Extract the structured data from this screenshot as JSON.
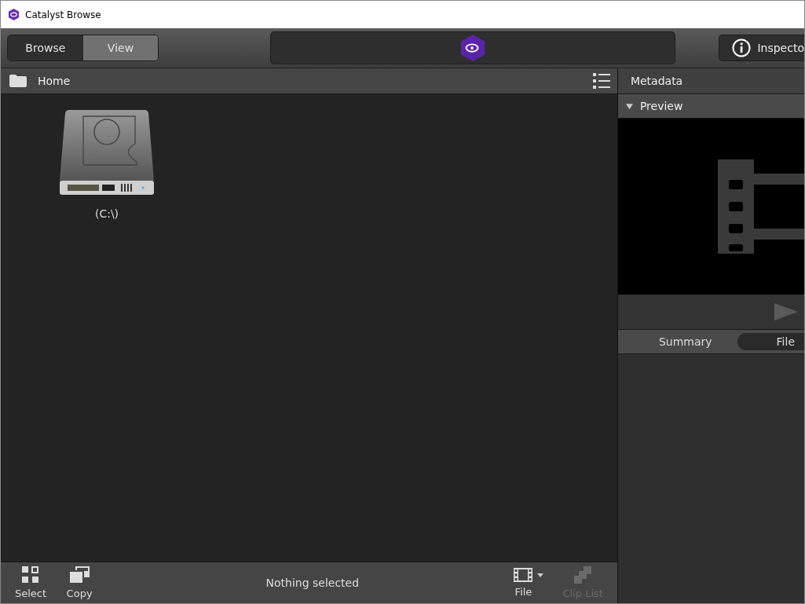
{
  "window": {
    "title": "Catalyst Browse"
  },
  "mode_tabs": [
    {
      "label": "Browse",
      "selected": false
    },
    {
      "label": "View",
      "selected": true
    }
  ],
  "inspector_button": {
    "label": "Inspecto"
  },
  "location": {
    "label": "Home"
  },
  "items": [
    {
      "label": "(C:\\)"
    }
  ],
  "metadata": {
    "title": "Metadata",
    "preview": {
      "label": "Preview",
      "expanded": true
    },
    "tabs": [
      {
        "label": "Summary",
        "selected": false
      },
      {
        "label": "File",
        "selected": true
      }
    ]
  },
  "footer": {
    "status": "Nothing selected",
    "actions": [
      {
        "kind": "select",
        "label": "Select",
        "disabled": false
      },
      {
        "kind": "copy",
        "label": "Copy",
        "disabled": false
      },
      {
        "kind": "file",
        "label": "File",
        "disabled": false
      },
      {
        "kind": "cliplist",
        "label": "Clip List",
        "disabled": true
      }
    ]
  }
}
